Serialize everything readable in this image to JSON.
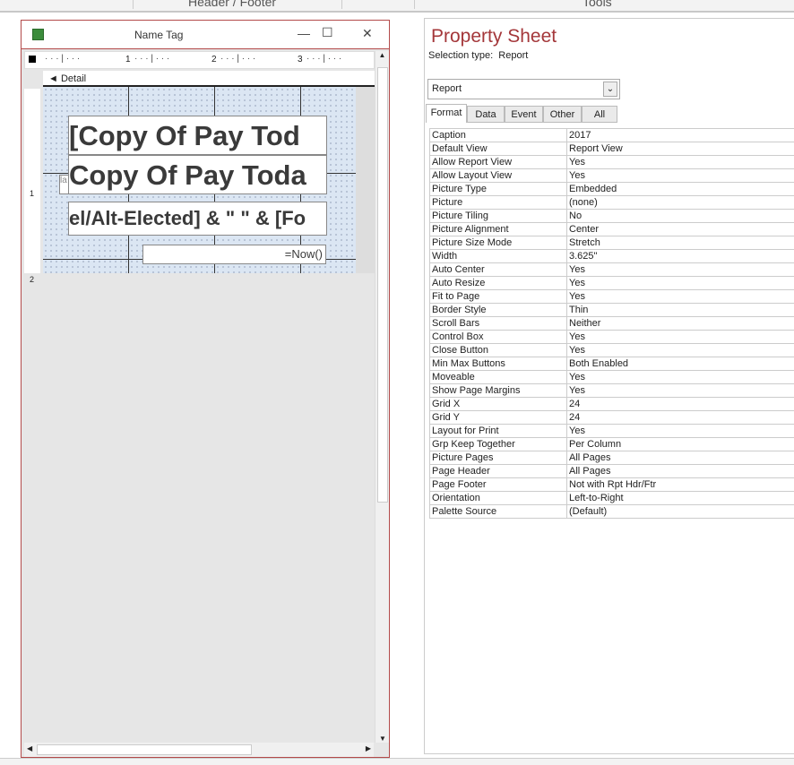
{
  "top": {
    "header_footer": "Header / Footer",
    "tools": "Tools"
  },
  "window": {
    "title": "Name Tag",
    "section": "Detail",
    "ruler_labels": [
      "1",
      "2",
      "3"
    ],
    "vruler_labels": [
      "1",
      "2"
    ]
  },
  "controls": {
    "line1": "[Copy Of Pay Tod",
    "line2": "Copy Of Pay Toda",
    "line3": "el/Alt-Elected] & \"  \" & [Fo",
    "now": "=Now()",
    "label_stub": "la"
  },
  "property_sheet": {
    "title": "Property Sheet",
    "selection_type_label": "Selection type:",
    "selection_type": "Report",
    "object_select": "Report",
    "tabs": [
      "Format",
      "Data",
      "Event",
      "Other",
      "All"
    ],
    "active_tab": "Format",
    "rows": [
      [
        "Caption",
        "2017"
      ],
      [
        "Default View",
        "Report View"
      ],
      [
        "Allow Report View",
        "Yes"
      ],
      [
        "Allow Layout View",
        "Yes"
      ],
      [
        "Picture Type",
        "Embedded"
      ],
      [
        "Picture",
        "(none)"
      ],
      [
        "Picture Tiling",
        "No"
      ],
      [
        "Picture Alignment",
        "Center"
      ],
      [
        "Picture Size Mode",
        "Stretch"
      ],
      [
        "Width",
        "3.625\""
      ],
      [
        "Auto Center",
        "Yes"
      ],
      [
        "Auto Resize",
        "Yes"
      ],
      [
        "Fit to Page",
        "Yes"
      ],
      [
        "Border Style",
        "Thin"
      ],
      [
        "Scroll Bars",
        "Neither"
      ],
      [
        "Control Box",
        "Yes"
      ],
      [
        "Close Button",
        "Yes"
      ],
      [
        "Min Max Buttons",
        "Both Enabled"
      ],
      [
        "Moveable",
        "Yes"
      ],
      [
        "Show Page Margins",
        "Yes"
      ],
      [
        "Grid X",
        "24"
      ],
      [
        "Grid Y",
        "24"
      ],
      [
        "Layout for Print",
        "Yes"
      ],
      [
        "Grp Keep Together",
        "Per Column"
      ],
      [
        "Picture Pages",
        "All Pages"
      ],
      [
        "Page Header",
        "All Pages"
      ],
      [
        "Page Footer",
        "Not with Rpt Hdr/Ftr"
      ],
      [
        "Orientation",
        "Left-to-Right"
      ],
      [
        "Palette Source",
        "(Default)"
      ]
    ]
  }
}
